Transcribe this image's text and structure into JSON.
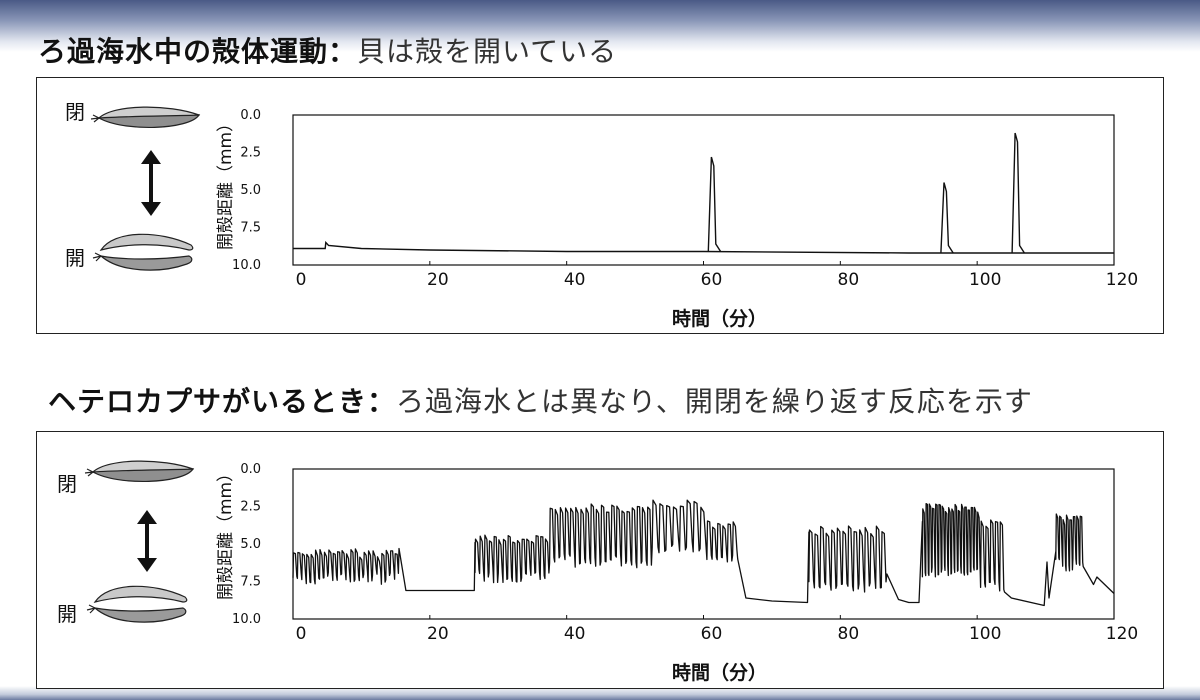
{
  "heading1": {
    "bold": "ろ過海水中の殻体運動：",
    "normal": "貝は殻を開いている"
  },
  "heading2": {
    "bold": "ヘテロカプサがいるとき：",
    "normal": "ろ過海水とは異なり、開閉を繰り返す反応を示す"
  },
  "shell_labels": {
    "closed": "閉",
    "open": "開"
  },
  "chart_data": [
    {
      "type": "line",
      "ylabel": "開殻距離（mm）",
      "xlabel": "時間（分）",
      "xlim": [
        0,
        120
      ],
      "ylim": [
        0,
        10
      ],
      "y_inverted": true,
      "xticks": [
        "0",
        "20",
        "40",
        "60",
        "80",
        "100",
        "120"
      ],
      "yticks": [
        "0.0",
        "2.5",
        "5.0",
        "7.5",
        "10.0"
      ],
      "baseline": [
        [
          0,
          8.9
        ],
        [
          4.7,
          8.9
        ],
        [
          4.8,
          8.5
        ],
        [
          5.2,
          8.7
        ],
        [
          10,
          8.9
        ],
        [
          20,
          9.0
        ],
        [
          40,
          9.1
        ],
        [
          60,
          9.1
        ],
        [
          90,
          9.2
        ],
        [
          120,
          9.2
        ]
      ],
      "spikes": [
        {
          "x": 61.3,
          "y": 2.8,
          "base": 9.1
        },
        {
          "x": 95.3,
          "y": 4.5,
          "base": 9.2
        },
        {
          "x": 105.7,
          "y": 1.2,
          "base": 9.2
        }
      ]
    },
    {
      "type": "line",
      "ylabel": "開殻距離（mm）",
      "xlabel": "時間（分）",
      "xlim": [
        0,
        120
      ],
      "ylim": [
        0,
        10
      ],
      "y_inverted": true,
      "xticks": [
        "0",
        "20",
        "40",
        "60",
        "80",
        "100",
        "120"
      ],
      "yticks": [
        "0.0",
        "2.5",
        "5.0",
        "7.5",
        "10.0"
      ],
      "segments": [
        {
          "type": "osc",
          "x0": 0,
          "x1": 15.5,
          "low": 5.3,
          "high": 7.7,
          "n": 24
        },
        {
          "type": "line",
          "pts": [
            [
              15.5,
              5.3
            ],
            [
              16.5,
              8.1
            ],
            [
              26.5,
              8.1
            ],
            [
              26.6,
              4.9
            ]
          ]
        },
        {
          "type": "osc",
          "x0": 26.6,
          "x1": 37.5,
          "low": 4.4,
          "high": 7.6,
          "n": 16
        },
        {
          "type": "osc",
          "x0": 37.5,
          "x1": 52.5,
          "low": 2.3,
          "high": 6.6,
          "n": 20
        },
        {
          "type": "osc",
          "x0": 52.5,
          "x1": 60.5,
          "low": 2.0,
          "high": 5.8,
          "n": 8
        },
        {
          "type": "osc",
          "x0": 60.5,
          "x1": 65.0,
          "low": 3.3,
          "high": 6.5,
          "n": 6
        },
        {
          "type": "line",
          "pts": [
            [
              65.0,
              6.0
            ],
            [
              66.2,
              8.6
            ],
            [
              70,
              8.8
            ],
            [
              75.2,
              8.9
            ],
            [
              75.4,
              4.2
            ]
          ]
        },
        {
          "type": "osc",
          "x0": 75.4,
          "x1": 86.8,
          "low": 3.8,
          "high": 8.2,
          "n": 14
        },
        {
          "type": "line",
          "pts": [
            [
              86.8,
              7.0
            ],
            [
              88.5,
              8.7
            ],
            [
              90.0,
              8.9
            ],
            [
              91.5,
              8.9
            ],
            [
              92.0,
              3.5
            ]
          ]
        },
        {
          "type": "osc",
          "x0": 92.0,
          "x1": 100.5,
          "low": 2.3,
          "high": 7.3,
          "n": 18
        },
        {
          "type": "osc",
          "x0": 100.5,
          "x1": 104.0,
          "low": 3.3,
          "high": 8.2,
          "n": 5
        },
        {
          "type": "line",
          "pts": [
            [
              104.0,
              8.2
            ],
            [
              105.0,
              8.6
            ],
            [
              109.8,
              9.1
            ],
            [
              110.2,
              6.2
            ],
            [
              110.5,
              8.6
            ],
            [
              111.5,
              5.5
            ]
          ]
        },
        {
          "type": "osc",
          "x0": 111.5,
          "x1": 115.5,
          "low": 3.0,
          "high": 6.8,
          "n": 8
        },
        {
          "type": "line",
          "pts": [
            [
              115.5,
              6.5
            ],
            [
              117.0,
              7.7
            ],
            [
              117.5,
              7.2
            ],
            [
              120.0,
              8.3
            ]
          ]
        }
      ]
    }
  ]
}
